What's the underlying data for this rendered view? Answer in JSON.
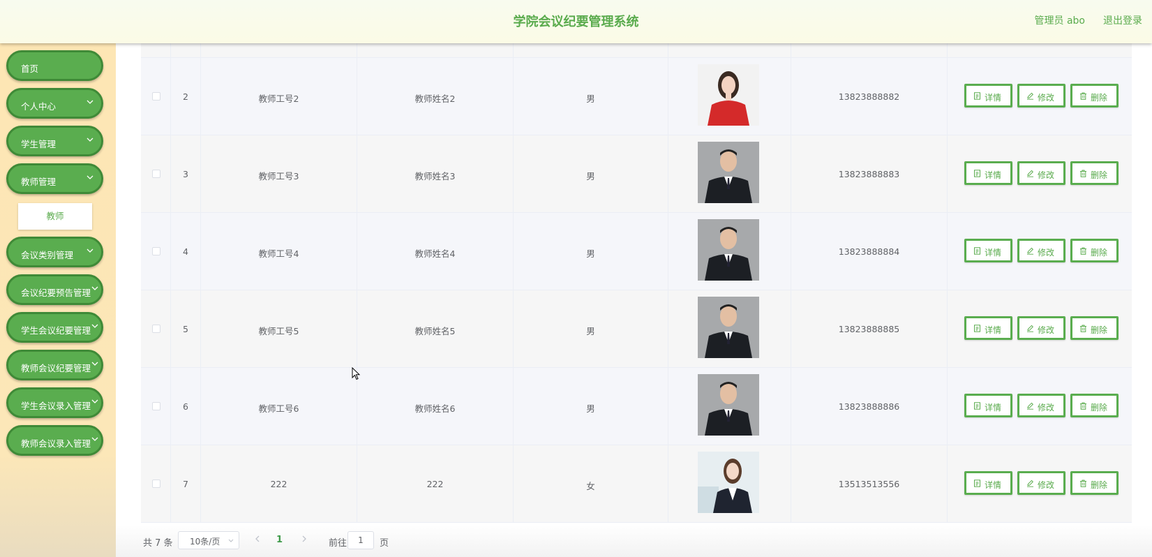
{
  "header": {
    "title": "学院会议纪要管理系统",
    "user_label": "管理员 abo",
    "logout_label": "退出登录"
  },
  "sidebar": {
    "items": [
      {
        "label": "首页",
        "has_arrow": false
      },
      {
        "label": "个人中心",
        "has_arrow": true
      },
      {
        "label": "学生管理",
        "has_arrow": true
      },
      {
        "label": "教师管理",
        "has_arrow": true,
        "expanded": true
      },
      {
        "label": "会议类别管理",
        "has_arrow": true
      },
      {
        "label": "会议纪要预告管理",
        "has_arrow": true
      },
      {
        "label": "学生会议纪要管理",
        "has_arrow": true
      },
      {
        "label": "教师会议纪要管理",
        "has_arrow": true
      },
      {
        "label": "学生会议录入管理",
        "has_arrow": true
      },
      {
        "label": "教师会议录入管理",
        "has_arrow": true
      }
    ],
    "submenu": {
      "label": "教师"
    }
  },
  "table": {
    "rows": [
      {
        "index": "2",
        "teacher_id": "教师工号2",
        "teacher_name": "教师姓名2",
        "gender": "男",
        "phone": "13823888882",
        "photo": "woman-red-portrait"
      },
      {
        "index": "3",
        "teacher_id": "教师工号3",
        "teacher_name": "教师姓名3",
        "gender": "男",
        "phone": "13823888883",
        "photo": "man-suit-portrait"
      },
      {
        "index": "4",
        "teacher_id": "教师工号4",
        "teacher_name": "教师姓名4",
        "gender": "男",
        "phone": "13823888884",
        "photo": "man-suit-portrait"
      },
      {
        "index": "5",
        "teacher_id": "教师工号5",
        "teacher_name": "教师姓名5",
        "gender": "男",
        "phone": "13823888885",
        "photo": "man-suit-portrait"
      },
      {
        "index": "6",
        "teacher_id": "教师工号6",
        "teacher_name": "教师姓名6",
        "gender": "男",
        "phone": "13823888886",
        "photo": "man-suit-portrait"
      },
      {
        "index": "7",
        "teacher_id": "222",
        "teacher_name": "222",
        "gender": "女",
        "phone": "13513513556",
        "photo": "woman-suit-portrait"
      }
    ],
    "actions": {
      "detail": "详情",
      "edit": "修改",
      "delete": "删除"
    }
  },
  "pagination": {
    "total": "共 7 条",
    "page_size": "10条/页",
    "current_page": "1",
    "goto_label": "前往",
    "goto_value": "1",
    "page_suffix": "页"
  },
  "colors": {
    "accent": "#5aab4d",
    "menu_bg": "#5aad4f",
    "sidebar_bg": "#fde6b4",
    "header_bg": "#f8fbef"
  }
}
